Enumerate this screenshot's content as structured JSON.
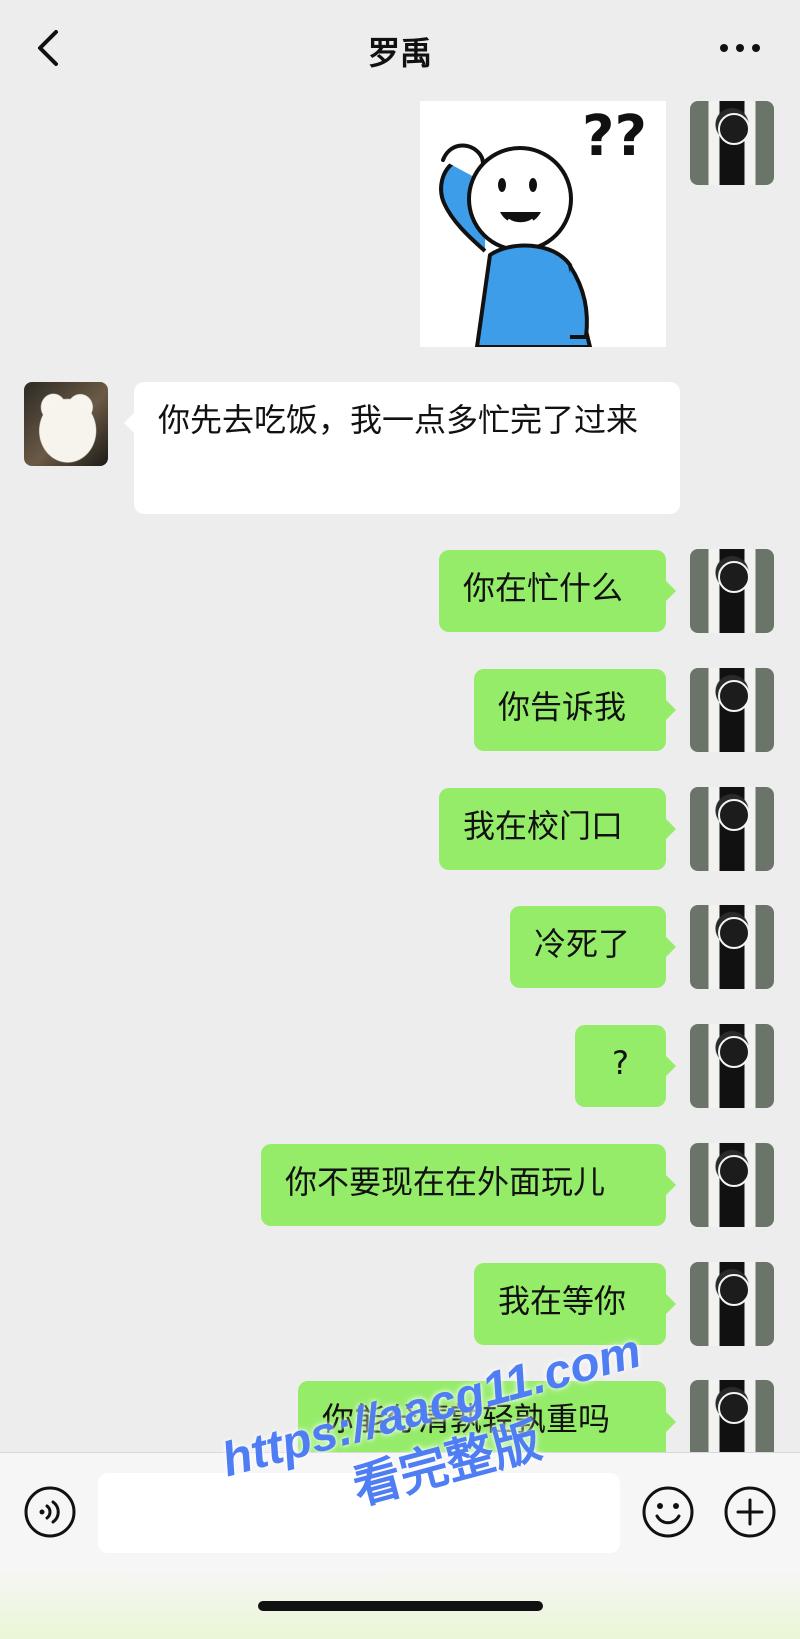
{
  "header": {
    "title": "罗禹"
  },
  "messages": {
    "incoming_1": "你先去吃饭，我一点多忙完了过来",
    "outgoing_1": "你在忙什么",
    "outgoing_2": "你告诉我",
    "outgoing_3": "我在校门口",
    "outgoing_4": "冷死了",
    "outgoing_5": "?",
    "outgoing_6": "你不要现在在外面玩儿",
    "outgoing_7": "我在等你",
    "outgoing_8": "你能分清孰轻孰重吗"
  },
  "sticker": {
    "text": "??"
  },
  "input": {
    "value": ""
  },
  "watermark": {
    "line1": "https://aacg11.com",
    "line2": "看完整版"
  }
}
